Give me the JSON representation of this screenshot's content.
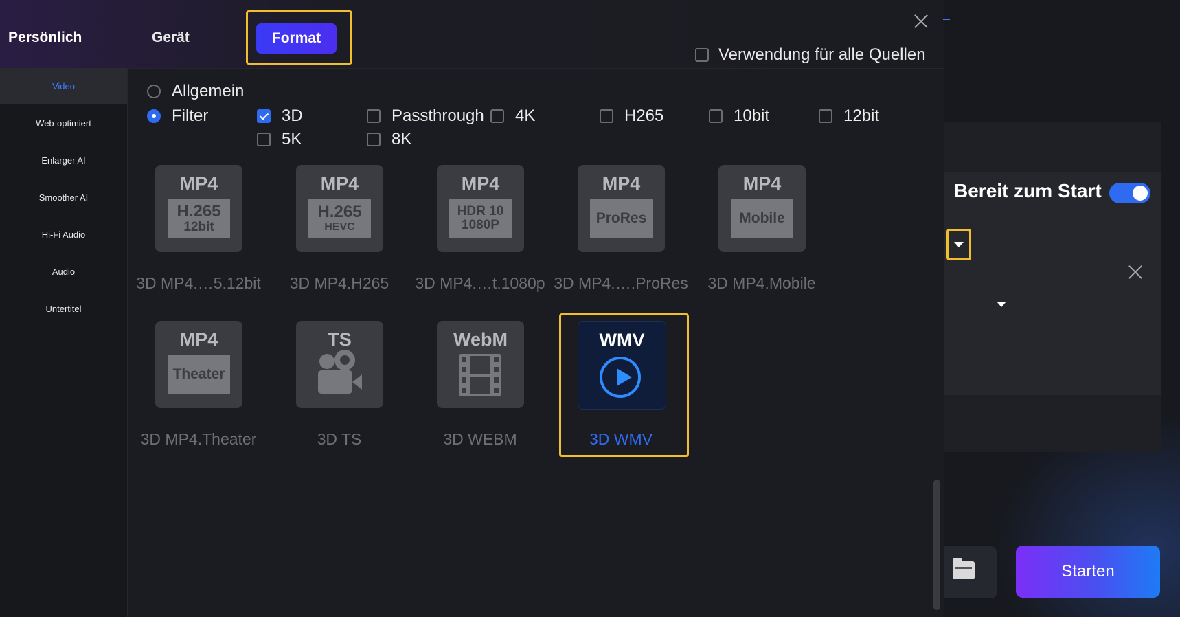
{
  "dialog": {
    "tabs": {
      "personal": "Persönlich",
      "device": "Gerät",
      "format": "Format"
    },
    "use_all_sources": "Verwendung für alle Quellen"
  },
  "sidebar": {
    "items": [
      {
        "label": "Video",
        "active": true
      },
      {
        "label": "Web-optimiert",
        "active": false
      },
      {
        "label": "Enlarger AI",
        "active": false
      },
      {
        "label": "Smoother AI",
        "active": false
      },
      {
        "label": "Hi-Fi Audio",
        "active": false
      },
      {
        "label": "Audio",
        "active": false
      },
      {
        "label": "Untertitel",
        "active": false
      }
    ]
  },
  "options": {
    "general": "Allgemein",
    "filter": "Filter",
    "checks": [
      {
        "label": "3D",
        "checked": true
      },
      {
        "label": "Passthrough",
        "checked": false
      },
      {
        "label": "4K",
        "checked": false
      },
      {
        "label": "H265",
        "checked": false
      },
      {
        "label": "10bit",
        "checked": false
      },
      {
        "label": "12bit",
        "checked": false
      },
      {
        "label": "5K",
        "checked": false
      },
      {
        "label": "8K",
        "checked": false
      }
    ]
  },
  "formats": [
    {
      "top": "MP4",
      "plate": [
        "H.265",
        "12bit"
      ],
      "caption": "3D MP4.…5.12bit"
    },
    {
      "top": "MP4",
      "plate": [
        "H.265",
        "HEVC"
      ],
      "caption": "3D MP4.H265"
    },
    {
      "top": "MP4",
      "plate": [
        "HDR 10",
        "1080P"
      ],
      "caption": "3D MP4.…t.1080p"
    },
    {
      "top": "MP4",
      "plate": [
        "ProRes"
      ],
      "caption": "3D MP4.….ProRes"
    },
    {
      "top": "MP4",
      "plate": [
        "Mobile"
      ],
      "caption": "3D MP4.Mobile"
    },
    {
      "top": "MP4",
      "plate": [
        "Theater"
      ],
      "caption": "3D MP4.Theater"
    },
    {
      "top": "TS",
      "icon": "video-camera-icon",
      "caption": "3D TS"
    },
    {
      "top": "WebM",
      "icon": "film-strip-icon",
      "caption": "3D WEBM"
    },
    {
      "top": "WMV",
      "icon": "play-circle-icon",
      "caption": "3D WMV",
      "selected": true
    }
  ],
  "right_panel": {
    "ready_label": "Bereit zum Start",
    "ready_on": true,
    "start_button": "Starten"
  },
  "colors": {
    "accent": "#2f6bf0",
    "highlight": "#f2be2d",
    "start_gradient": [
      "#7b2ff7",
      "#1e7bf5"
    ]
  }
}
